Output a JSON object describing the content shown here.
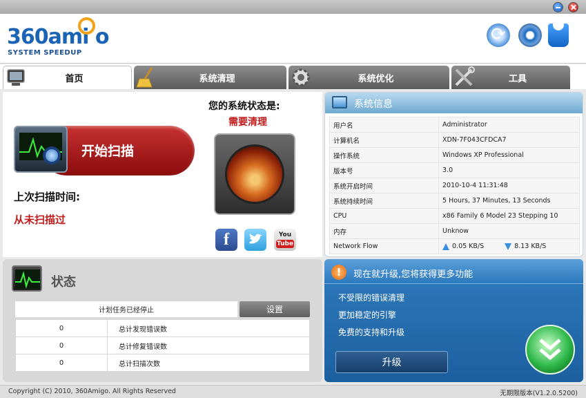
{
  "header": {
    "logo_main_a": "360",
    "logo_main_b": "ami",
    "logo_main_c": "o",
    "logo_sub": "SYSTEM SPEEDUP"
  },
  "tabs": [
    {
      "label": "首页",
      "icon": "home-monitor-icon",
      "active": true
    },
    {
      "label": "系统清理",
      "icon": "broom-icon",
      "active": false
    },
    {
      "label": "系统优化",
      "icon": "gear-icon",
      "active": false
    },
    {
      "label": "工具",
      "icon": "tools-icon",
      "active": false
    }
  ],
  "scan": {
    "button_label": "开始扫描",
    "last_scan_title": "上次扫描时间:",
    "last_scan_value": "从未扫描过",
    "status_title": "您的系统状态是:",
    "status_value": "需要清理"
  },
  "social": {
    "facebook": "f",
    "youtube_you": "You",
    "youtube_tube": "Tube"
  },
  "sysinfo": {
    "title": "系统信息",
    "rows": [
      {
        "key": "用户名",
        "value": "Administrator"
      },
      {
        "key": "计算机名",
        "value": "XDN-7F043CFDCA7"
      },
      {
        "key": "操作系统",
        "value": "Windows XP Professional"
      },
      {
        "key": "版本号",
        "value": "3.0"
      },
      {
        "key": "系统开启时间",
        "value": "2010-10-4 11:31:48"
      },
      {
        "key": "系统持续时间",
        "value": "5 Hours, 37 Minutes, 13 Seconds"
      },
      {
        "key": "CPU",
        "value": "x86 Family 6 Model 23 Stepping 10"
      },
      {
        "key": "内存",
        "value": "Unknow"
      }
    ],
    "network": {
      "key": "Network Flow",
      "up": "0.05 KB/S",
      "down": "8.13 KB/S"
    }
  },
  "status": {
    "title": "状态",
    "task": "计划任务已经停止",
    "settings_label": "设置",
    "rows": [
      {
        "count": "0",
        "label": "总计发现错误数"
      },
      {
        "count": "0",
        "label": "总计修复错误数"
      },
      {
        "count": "0",
        "label": "总计扫描次数"
      }
    ]
  },
  "upgrade": {
    "title": "现在就升级,您将获得更多功能",
    "features": [
      "不受限的错误清理",
      "更加稳定的引擎",
      "免费的支持和升级"
    ],
    "button_label": "升级"
  },
  "footer": {
    "copyright": "Copyright (C) 2010, 360Amigo. All Rights Reserved",
    "version": "无期限版本(V1.2.0.5200)"
  },
  "colors": {
    "accent_blue": "#2c79bd",
    "alert_red": "#c01c1c",
    "scan_red": "#a61b1b"
  }
}
